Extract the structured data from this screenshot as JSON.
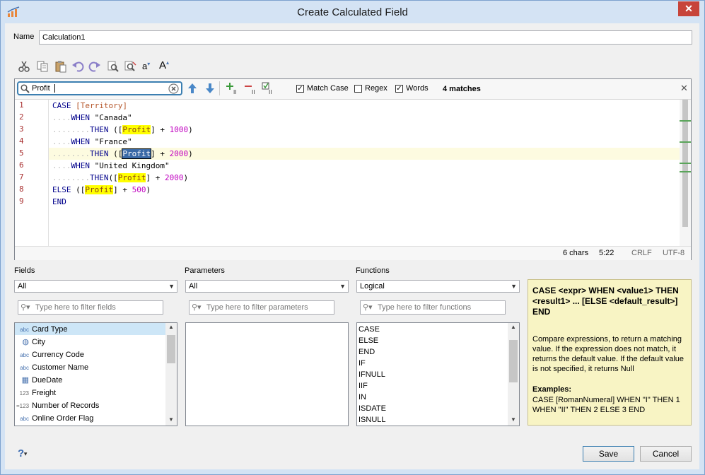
{
  "window": {
    "title": "Create Calculated Field",
    "close_glyph": "✕"
  },
  "name_field": {
    "label": "Name",
    "value": "Calculation1"
  },
  "toolbar": {
    "icons": [
      "scissors-icon",
      "copy-icon",
      "paste-icon",
      "undo-icon",
      "redo-icon",
      "find-icon",
      "replace-icon",
      "decrease-font-icon",
      "increase-font-icon"
    ],
    "font_small": "a",
    "font_large": "A"
  },
  "search": {
    "value": "Profit",
    "match_case_label": "Match Case",
    "match_case_checked": true,
    "regex_label": "Regex",
    "regex_checked": false,
    "words_label": "Words",
    "words_checked": true,
    "match_count": "4 matches"
  },
  "editor": {
    "line_numbers": [
      "1",
      "2",
      "3",
      "4",
      "5",
      "6",
      "7",
      "8",
      "9"
    ],
    "status": {
      "chars": "6 chars",
      "position": "5:22",
      "line_ending": "CRLF",
      "encoding": "UTF-8"
    }
  },
  "fields_panel": {
    "label": "Fields",
    "combo_value": "All",
    "filter_placeholder": "Type here to filter fields",
    "items": [
      {
        "icon": "abc",
        "label": "Card Type"
      },
      {
        "icon": "◍",
        "label": "City"
      },
      {
        "icon": "abc",
        "label": "Currency Code"
      },
      {
        "icon": "abc",
        "label": "Customer Name"
      },
      {
        "icon": "▦",
        "label": "DueDate"
      },
      {
        "icon": "123",
        "label": "Freight"
      },
      {
        "icon": "=123",
        "label": "Number of Records"
      },
      {
        "icon": "abc",
        "label": "Online Order Flag"
      }
    ]
  },
  "parameters_panel": {
    "label": "Parameters",
    "combo_value": "All",
    "filter_placeholder": "Type here to filter parameters"
  },
  "functions_panel": {
    "label": "Functions",
    "combo_value": "Logical",
    "filter_placeholder": "Type here to filter functions",
    "items": [
      "CASE",
      "ELSE",
      "END",
      "IF",
      "IFNULL",
      "IIF",
      "IN",
      "ISDATE",
      "ISNULL"
    ]
  },
  "help": {
    "signature": "CASE <expr> WHEN <value1> THEN <result1> ... [ELSE <default_result>] END",
    "description": "Compare expressions, to return a matching value. If the expression does not match, it returns the default value. If the default value is not specified, it returns Null",
    "examples_heading": "Examples:",
    "example": "CASE [RomanNumeral] WHEN \"I\" THEN 1 WHEN \"II\" THEN 2 ELSE 3 END"
  },
  "footer": {
    "help_glyph": "?",
    "save_label": "Save",
    "cancel_label": "Cancel"
  }
}
